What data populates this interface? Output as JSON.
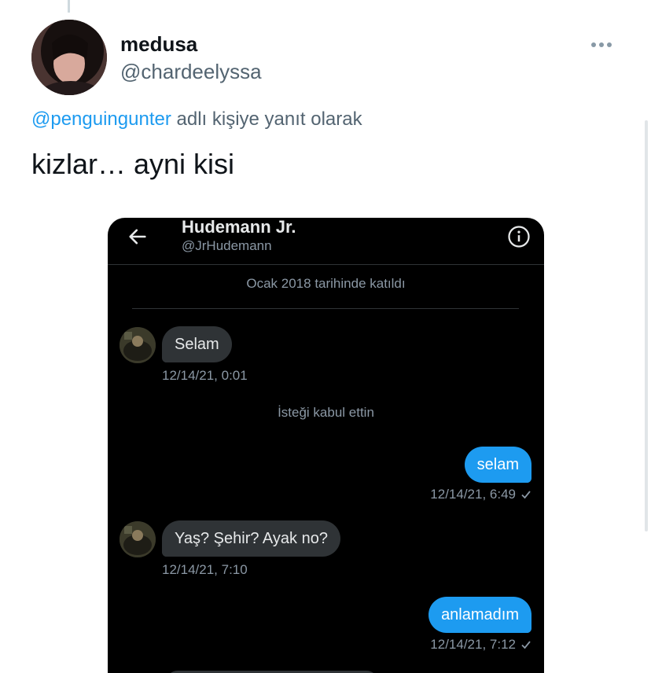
{
  "tweet": {
    "display_name": "medusa",
    "handle": "@chardeelyssa",
    "reply_mention": "@penguingunter",
    "reply_suffix": " adlı kişiye yanıt olarak",
    "text": "kizlar… ayni kisi"
  },
  "dm": {
    "name": "Hudemann Jr.",
    "handle": "@JrHudemann",
    "joined": "Ocak 2018 tarihinde katıldı",
    "accepted_notice": "İsteği kabul ettin",
    "messages": [
      {
        "direction": "in",
        "text": "Selam",
        "time": "12/14/21, 0:01"
      },
      {
        "direction": "out",
        "text": "selam",
        "time": "12/14/21, 6:49"
      },
      {
        "direction": "in",
        "text": "Yaş? Şehir? Ayak no?",
        "time": "12/14/21, 7:10"
      },
      {
        "direction": "out",
        "text": "anlamadım",
        "time": "12/14/21, 7:12"
      }
    ]
  },
  "icons": {
    "more": "more-horizontal-icon",
    "back": "arrow-left-icon",
    "info": "info-icon",
    "read": "checkmark-icon"
  },
  "colors": {
    "link": "#1d9bf0",
    "outgoing_bubble": "#1d9bf0",
    "incoming_bubble": "#2f3336",
    "dm_background": "#000000"
  }
}
